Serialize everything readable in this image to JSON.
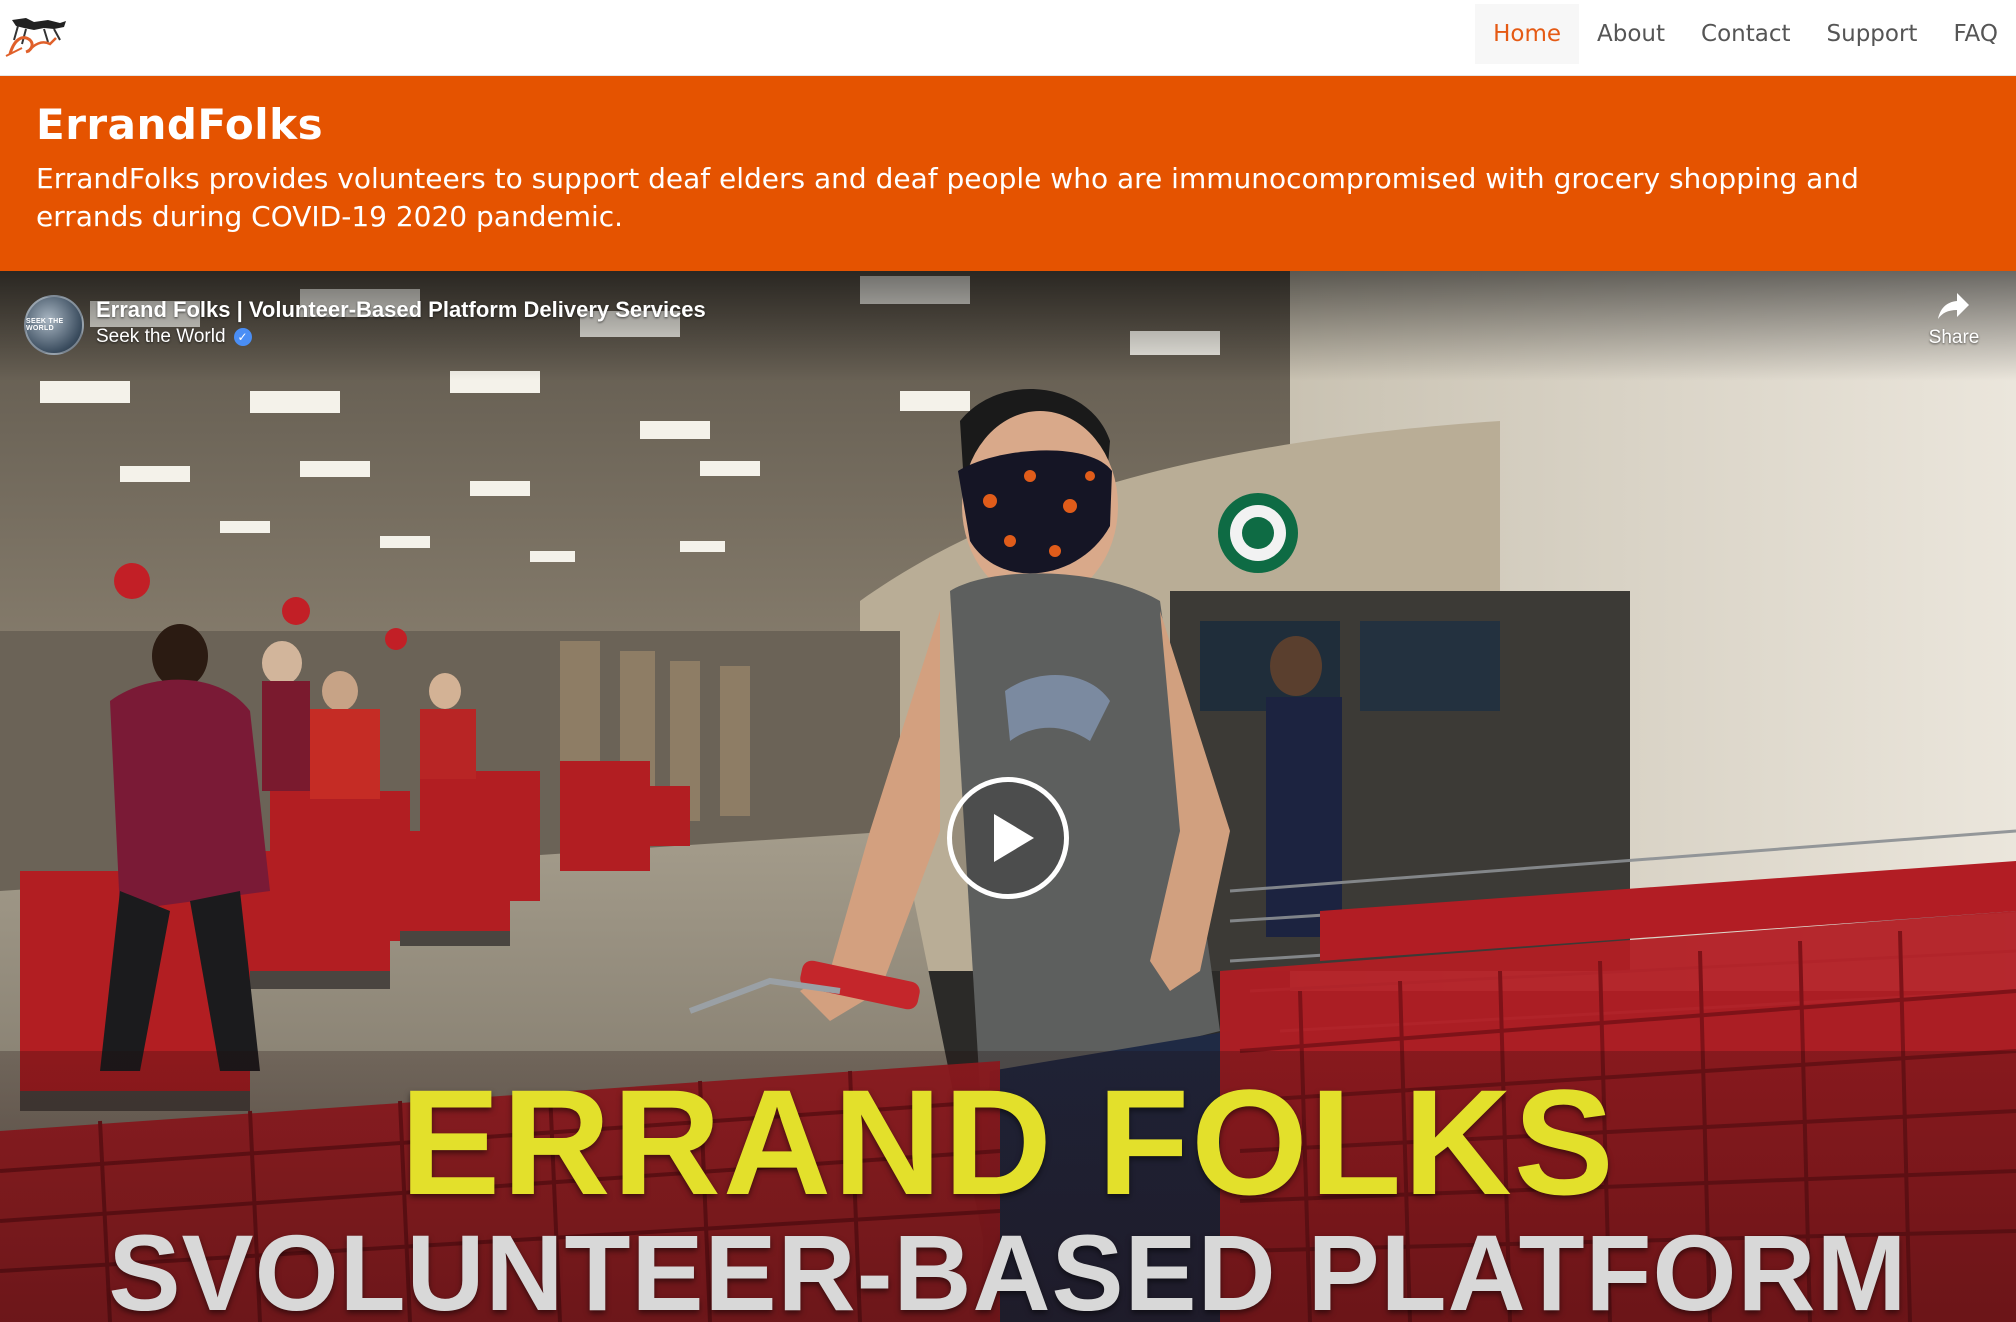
{
  "nav": {
    "items": [
      {
        "label": "Home",
        "active": true
      },
      {
        "label": "About",
        "active": false
      },
      {
        "label": "Contact",
        "active": false
      },
      {
        "label": "Support",
        "active": false
      },
      {
        "label": "FAQ",
        "active": false
      }
    ],
    "accent_color": "#e55a14"
  },
  "hero": {
    "title": "ErrandFolks",
    "description": "ErrandFolks provides volunteers to support deaf elders and deaf people who are immunocompromised with grocery shopping and errands during COVID-19 2020 pandemic.",
    "background_color": "#e55300"
  },
  "video": {
    "title": "Errand Folks | Volunteer-Based Platform Delivery Services",
    "channel": "Seek the World",
    "channel_avatar_text": "SEEK THE WORLD",
    "share_label": "Share",
    "caption_line1": "ERRAND FOLKS",
    "caption_line2": "SVOLUNTEER-BASED PLATFORM",
    "caption_line1_color": "#e3e02b"
  }
}
